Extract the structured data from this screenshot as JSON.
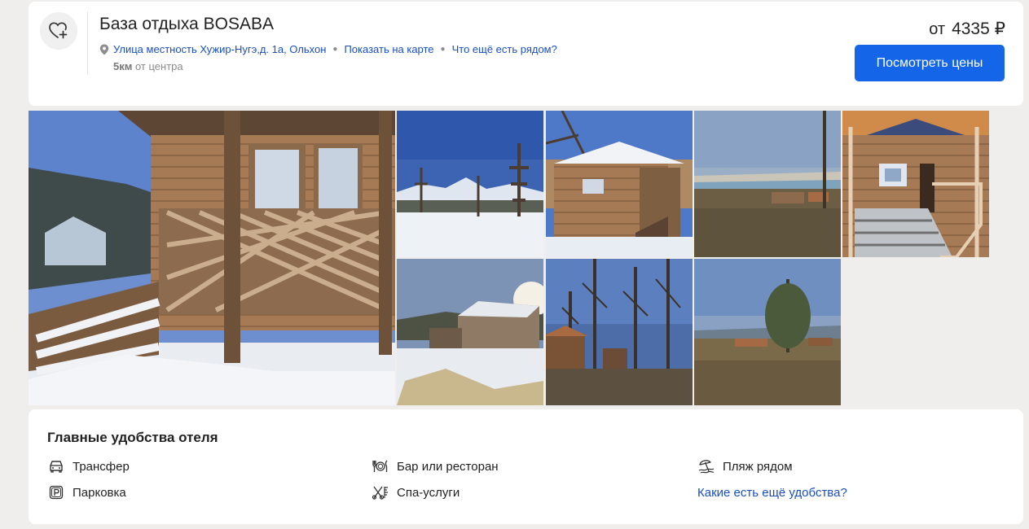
{
  "hotel": {
    "title": "База отдыха BOSABA",
    "address": "Улица местность Хужир-Нугэ,д. 1а, Ольхон",
    "show_on_map": "Показать на карте",
    "nearby": "Что ещё есть рядом?",
    "distance_value": "5км",
    "distance_text": "от центра"
  },
  "price": {
    "prefix": "от",
    "amount": "4335 ₽",
    "button_label": "Посмотреть цены"
  },
  "gallery": {
    "photos": [
      "cabin-porch-winter",
      "snowy-hills-larches",
      "wooden-cabin-snow",
      "steppe-lake-view",
      "cabin-porch-stairs",
      "cabins-sunset-snow",
      "cabins-among-trees",
      "lone-tree-hill"
    ]
  },
  "amenities": {
    "title": "Главные удобства отеля",
    "items": [
      {
        "label": "Трансфер",
        "icon": "car-icon"
      },
      {
        "label": "Бар или ресторан",
        "icon": "cutlery-icon"
      },
      {
        "label": "Пляж рядом",
        "icon": "beach-icon"
      },
      {
        "label": "Парковка",
        "icon": "parking-icon"
      },
      {
        "label": "Спа-услуги",
        "icon": "spa-icon"
      }
    ],
    "more_link": "Какие есть ещё удобства?"
  },
  "colors": {
    "accent": "#1565e8",
    "link": "#1a4fc4",
    "background": "#efeeec"
  }
}
